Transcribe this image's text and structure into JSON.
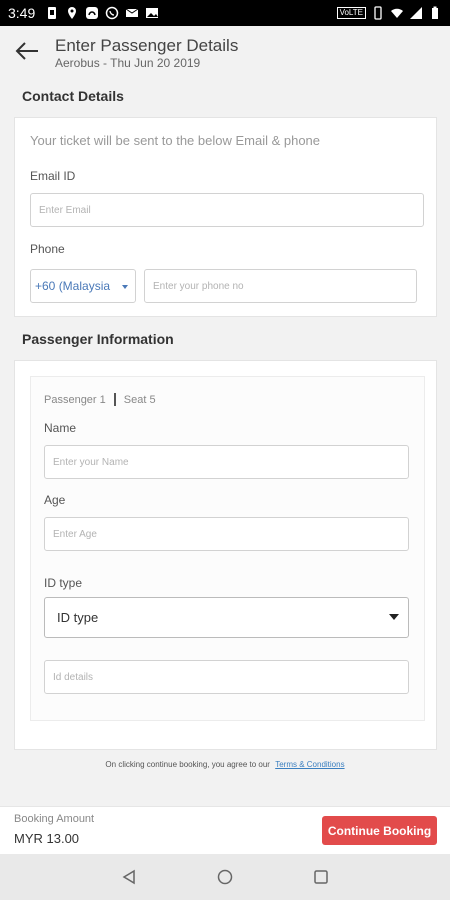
{
  "status_bar": {
    "time": "3:49",
    "volte": "VoLTE",
    "icons_left": [
      "notification-icon",
      "location-icon",
      "app-icon",
      "whatsapp-icon",
      "mail-icon",
      "image-icon"
    ],
    "icons_right": [
      "vibrate-icon",
      "wifi-icon",
      "signal-icon",
      "battery-icon"
    ]
  },
  "header": {
    "title": "Enter Passenger Details",
    "subtitle": "Aerobus - Thu Jun 20 2019"
  },
  "contact": {
    "section_title": "Contact Details",
    "helper": "Your ticket will be sent to the below Email & phone",
    "email_label": "Email ID",
    "email_placeholder": "Enter Email",
    "email_value": "",
    "phone_label": "Phone",
    "country_code": "+60 (Malaysia",
    "phone_placeholder": "Enter your phone no",
    "phone_value": ""
  },
  "passenger": {
    "section_title": "Passenger Information",
    "passenger_label": "Passenger 1",
    "seat_label": "Seat 5",
    "name_label": "Name",
    "name_placeholder": "Enter your Name",
    "age_label": "Age",
    "age_placeholder": "Enter Age",
    "id_type_label": "ID type",
    "id_type_selected": "ID type",
    "id_details_placeholder": "Id details"
  },
  "terms": {
    "text": "On clicking continue booking, you agree to our",
    "link": "Terms & Conditions"
  },
  "footer": {
    "amount_label": "Booking Amount",
    "amount_value": "MYR 13.00",
    "continue_label": "Continue Booking"
  },
  "colors": {
    "accent_red": "#e24b4b",
    "link_blue": "#3a7fc0",
    "country_blue": "#4a79b8"
  }
}
